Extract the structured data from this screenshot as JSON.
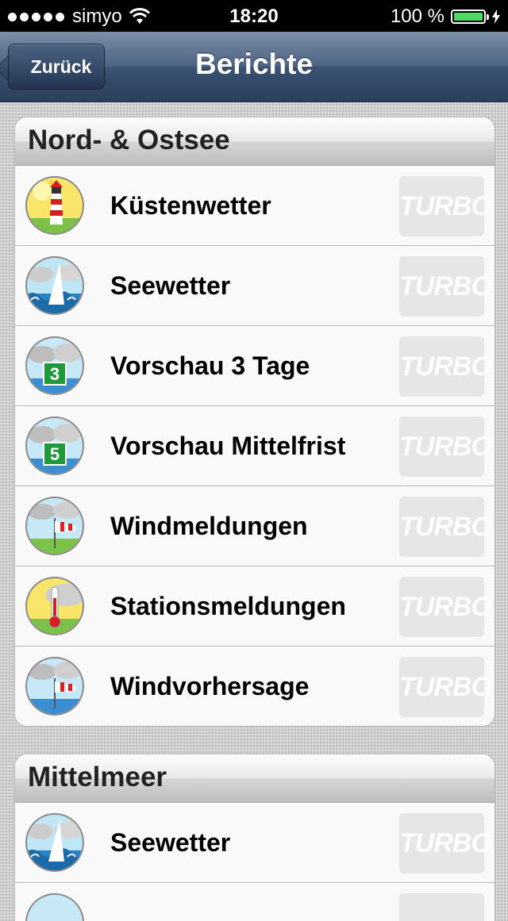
{
  "status_bar": {
    "carrier": "simyo",
    "time": "18:20",
    "battery": "100 %"
  },
  "navbar": {
    "back_label": "Zurück",
    "title": "Berichte"
  },
  "sections": [
    {
      "title": "Nord- & Ostsee",
      "items": [
        {
          "label": "Küstenwetter",
          "icon": "lighthouse-icon",
          "badge": "TURBO"
        },
        {
          "label": "Seewetter",
          "icon": "sailboat-waves-icon",
          "badge": "TURBO"
        },
        {
          "label": "Vorschau 3 Tage",
          "icon": "forecast-3-days-icon",
          "badge": "TURBO"
        },
        {
          "label": "Vorschau Mittelfrist",
          "icon": "forecast-5-days-icon",
          "badge": "TURBO"
        },
        {
          "label": "Windmeldungen",
          "icon": "windsock-icon",
          "badge": "TURBO"
        },
        {
          "label": "Stationsmeldungen",
          "icon": "thermometer-icon",
          "badge": "TURBO"
        },
        {
          "label": "Windvorhersage",
          "icon": "windsock-sea-icon",
          "badge": "TURBO"
        }
      ]
    },
    {
      "title": "Mittelmeer",
      "items": [
        {
          "label": "Seewetter",
          "icon": "sailboat-waves-icon",
          "badge": "TURBO"
        }
      ]
    }
  ]
}
